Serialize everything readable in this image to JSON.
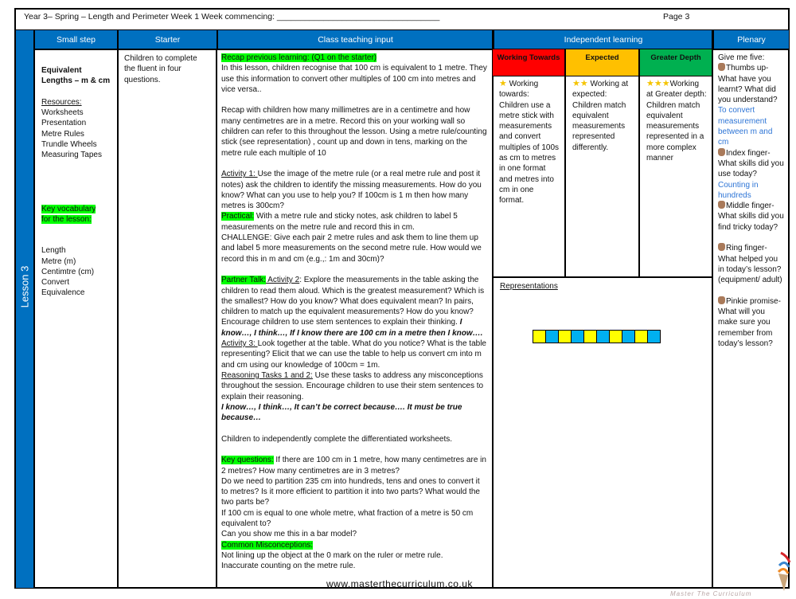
{
  "header": {
    "title": "Year 3– Spring – Length and Perimeter Week 1 Week commencing: ___________________________________",
    "page": "Page 3"
  },
  "lesson_label": "Lesson 3",
  "columns": {
    "small_step": "Small step",
    "starter": "Starter",
    "class_teaching": "Class teaching input",
    "independent": "Independent learning",
    "plenary": "Plenary"
  },
  "small_step": {
    "title_line1": "Equivalent",
    "title_line2": "Lengths – m & cm",
    "resources_label": "Resources:",
    "resources": [
      "Worksheets",
      "Presentation",
      "Metre Rules",
      "Trundle Wheels",
      "Measuring Tapes"
    ],
    "vocab_label_line1": "Key vocabulary",
    "vocab_label_line2": "for the lesson:",
    "vocab": [
      "Length",
      "Metre (m)",
      "Centimtre (cm)",
      "Convert",
      "Equivalence"
    ]
  },
  "starter": {
    "text": "Children to complete the fluent in four questions."
  },
  "class_teaching": [
    [
      {
        "s": "hl",
        "t": "Recap previous learning: (Q1 on the starter)"
      }
    ],
    [
      {
        "t": "In this lesson, children recognise that 100 cm is equivalent to 1 metre. They use this information to convert other multiples of 100 cm into metres and vice versa.."
      }
    ],
    [],
    [
      {
        "t": "Recap with children how many millimetres are in a centimetre and how many centimetres are in a metre.  Record this on your working wall so children can refer to this throughout the lesson. Using a metre rule/counting stick (see representation) , count up and down in tens, marking on the metre rule each multiple of 10"
      }
    ],
    [],
    [
      {
        "s": "u",
        "t": "Activity 1: "
      },
      {
        "t": " Use the image of the metre rule (or a real metre rule and post it notes) ask the children to identify the missing measurements.  How do you know?  What can you use to help you?  If 100cm is 1 m then how many metres is 300cm?"
      }
    ],
    [
      {
        "s": "hl",
        "t": "Practical:"
      },
      {
        "t": " With a metre rule and sticky notes, ask children to label 5 measurements on the metre rule and record this in cm."
      }
    ],
    [
      {
        "t": "CHALLENGE:  Give each pair 2 metre rules and ask them to line them up and label 5 more measurements on the second metre rule.  How would we record this in m and cm (e.g.,: 1m and 30cm)?"
      }
    ],
    [],
    [
      {
        "s": "hl",
        "t": "Partner Talk:"
      },
      {
        "s": "u",
        "t": " Activity 2"
      },
      {
        "t": ":  Explore the measurements in the table asking the children to read them aloud.  Which is the greatest measurement? Which is the smallest? How do you know?  What does equivalent mean? In pairs, children to match up the equivalent  measurements?  How do you know?  Encourage children to use stem sentences to explain their thinking.  "
      },
      {
        "s": "bi",
        "t": "I know…, I think…,  If I know there are 100 cm in a metre then I know…."
      }
    ],
    [
      {
        "s": "u",
        "t": "Activity 3: "
      },
      {
        "t": "Look together at the table.  What do you notice?  What is the table representing?  Elicit that we can use the table to help us convert cm into m and cm using our knowledge of 100cm = 1m."
      }
    ],
    [
      {
        "s": "u",
        "t": "Reasoning Tasks 1 and 2:"
      },
      {
        "t": " Use these tasks to address any misconceptions throughout the session.  Encourage children to use their stem sentences to explain their reasoning."
      }
    ],
    [
      {
        "s": "bi",
        "t": "I know…, I think…, It can’t be correct because…. It must be true because…"
      }
    ],
    [],
    [
      {
        "t": "Children to independently complete the differentiated worksheets."
      }
    ],
    [],
    [
      {
        "s": "hl",
        "t": "Key questions:"
      },
      {
        "t": " If there are 100 cm in 1 metre, how many centimetres are in 2 metres? How many centimetres are in 3 metres?"
      }
    ],
    [
      {
        "t": "Do we need to partition 235 cm into hundreds, tens and ones to convert it to metres? Is it more efficient to partition it into two parts? What would the two parts be?"
      }
    ],
    [
      {
        "t": "If 100 cm is equal to one whole metre, what fraction of a metre is 50 cm equivalent to?"
      }
    ],
    [
      {
        "t": "Can you show me this in a bar model?"
      }
    ],
    [
      {
        "s": "hl",
        "t": "Common Misconceptions:"
      }
    ],
    [
      {
        "t": "Not lining up the object at the 0 mark on the ruler or metre rule."
      }
    ],
    [
      {
        "t": "Inaccurate counting on the metre rule."
      }
    ]
  ],
  "independent": {
    "levels": [
      {
        "label": "Working Towards",
        "color": "#ff0000",
        "stars": "★",
        "text": " Working towards: Children use a metre stick with measurements and convert multiples of 100s as cm to metres in one format and metres into cm in one format."
      },
      {
        "label": "Expected",
        "color": "#ffc000",
        "stars": "★★",
        "text": " Working at expected: Children match equivalent measurements represented differently."
      },
      {
        "label": "Greater Depth",
        "color": "#00b050",
        "stars": "★★★",
        "text": "Working at Greater depth: Children match equivalent measurements represented in a more complex manner"
      }
    ],
    "representations_label": "Representations",
    "counting_stick_colors": [
      "#ffff00",
      "#00b0f0",
      "#ffff00",
      "#00b0f0",
      "#ffff00",
      "#00b0f0",
      "#ffff00",
      "#00b0f0",
      "#ffff00",
      "#00b0f0"
    ]
  },
  "plenary": [
    [
      {
        "t": "Give me five:"
      }
    ],
    [
      {
        "s": "hand"
      },
      {
        "t": "Thumbs up- What have you learnt? What did you understand?"
      }
    ],
    [
      {
        "s": "blue",
        "t": "To convert measurement between m and cm"
      }
    ],
    [
      {
        "s": "hand"
      },
      {
        "t": "Index finger- What skills did you use today?"
      }
    ],
    [
      {
        "s": "blue",
        "t": "Counting in hundreds"
      }
    ],
    [
      {
        "s": "hand"
      },
      {
        "t": "Middle finger- What skills did you find tricky today?"
      }
    ],
    [],
    [
      {
        "s": "hand"
      },
      {
        "t": "Ring finger- What helped you in today’s lesson? (equipment/ adult)"
      }
    ],
    [],
    [
      {
        "s": "hand"
      },
      {
        "t": "Pinkie promise- What will you make sure you remember from today’s lesson?"
      }
    ]
  ],
  "footer": {
    "url": "www.masterthecurriculum.co.uk",
    "logo_text": "Master The Curriculum"
  },
  "colors": {
    "header_blue": "#0070c0",
    "highlight": "#00ff00",
    "plenary_blue": "#2e75d6"
  }
}
